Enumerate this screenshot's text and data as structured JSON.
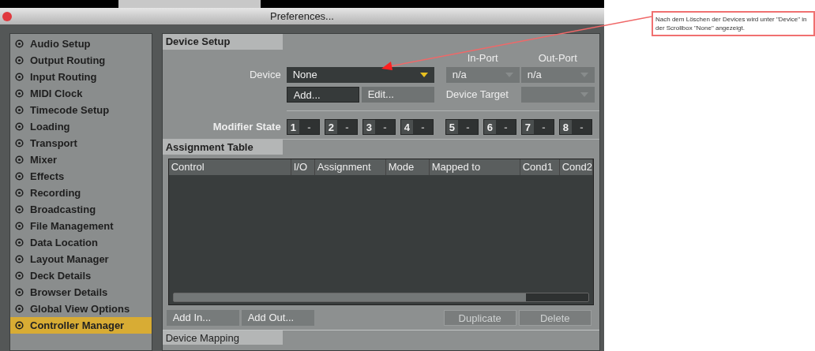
{
  "window": {
    "title": "Preferences..."
  },
  "sidebar": {
    "items": [
      {
        "label": "Audio Setup",
        "selected": false
      },
      {
        "label": "Output Routing",
        "selected": false
      },
      {
        "label": "Input Routing",
        "selected": false
      },
      {
        "label": "MIDI Clock",
        "selected": false
      },
      {
        "label": "Timecode Setup",
        "selected": false
      },
      {
        "label": "Loading",
        "selected": false
      },
      {
        "label": "Transport",
        "selected": false
      },
      {
        "label": "Mixer",
        "selected": false
      },
      {
        "label": "Effects",
        "selected": false
      },
      {
        "label": "Recording",
        "selected": false
      },
      {
        "label": "Broadcasting",
        "selected": false
      },
      {
        "label": "File Management",
        "selected": false
      },
      {
        "label": "Data Location",
        "selected": false
      },
      {
        "label": "Layout Manager",
        "selected": false
      },
      {
        "label": "Deck Details",
        "selected": false
      },
      {
        "label": "Browser Details",
        "selected": false
      },
      {
        "label": "Global View Options",
        "selected": false
      },
      {
        "label": "Controller Manager",
        "selected": true
      }
    ]
  },
  "device_setup": {
    "title": "Device Setup",
    "device_label": "Device",
    "device_value": "None",
    "in_port_label": "In-Port",
    "in_port_value": "n/a",
    "out_port_label": "Out-Port",
    "out_port_value": "n/a",
    "add_button": "Add...",
    "edit_button": "Edit...",
    "device_target_label": "Device Target",
    "modifier_label": "Modifier State",
    "modifiers": [
      {
        "number": "1",
        "value": "-"
      },
      {
        "number": "2",
        "value": "-"
      },
      {
        "number": "3",
        "value": "-"
      },
      {
        "number": "4",
        "value": "-"
      },
      {
        "number": "5",
        "value": "-"
      },
      {
        "number": "6",
        "value": "-"
      },
      {
        "number": "7",
        "value": "-"
      },
      {
        "number": "8",
        "value": "-"
      }
    ]
  },
  "assignment_table": {
    "title": "Assignment Table",
    "columns": [
      "Control",
      "I/O",
      "Assignment",
      "Mode",
      "Mapped to",
      "Cond1",
      "Cond2"
    ],
    "buttons": [
      {
        "label": "Add In...",
        "disabled": false
      },
      {
        "label": "Add Out...",
        "disabled": false
      },
      {
        "label": "Duplicate",
        "disabled": true
      },
      {
        "label": "Delete",
        "disabled": true
      }
    ]
  },
  "device_mapping": {
    "title": "Device Mapping"
  },
  "annotation": {
    "text": "Nach dem Löschen der Devices wird unter \"Device\" in der Scrollbox \"None\" angezeigt."
  }
}
